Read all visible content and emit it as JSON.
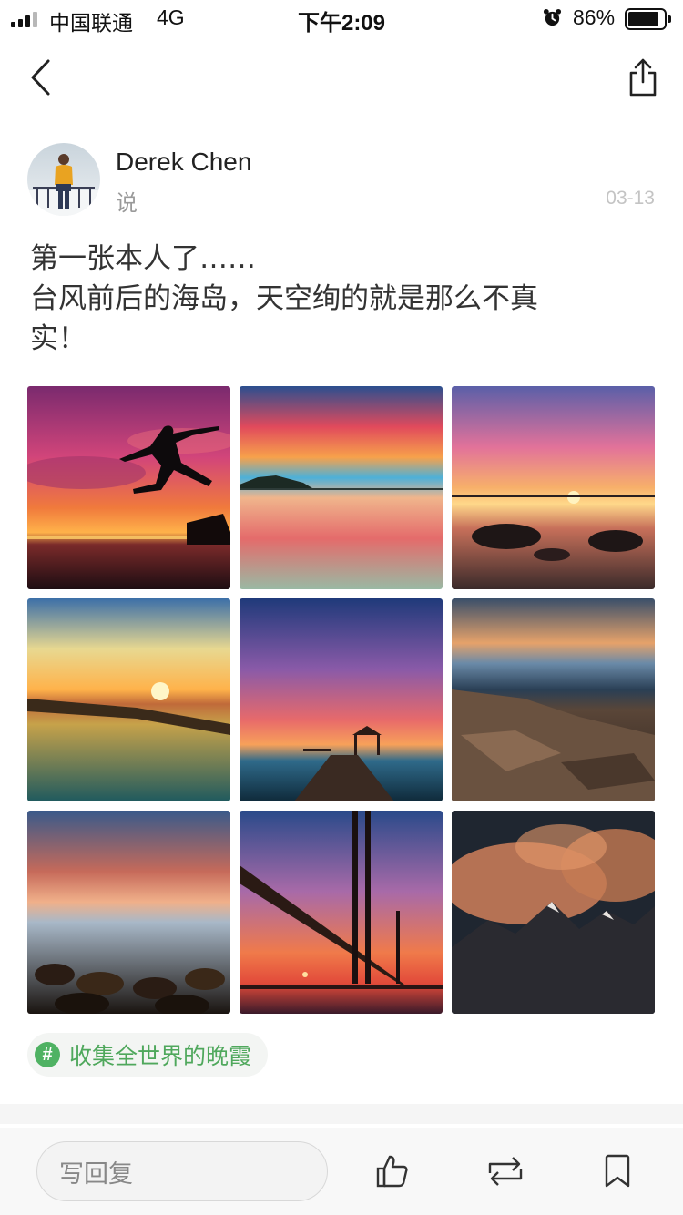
{
  "status_bar": {
    "carrier": "中国联通",
    "network": "4G",
    "time": "下午2:09",
    "battery_percent": "86%",
    "battery_level": 0.86,
    "signal_bars": 3,
    "icons": [
      "signal-icon",
      "alarm-icon",
      "battery-icon"
    ]
  },
  "nav": {
    "back_icon": "chevron-left-icon",
    "share_icon": "share-icon"
  },
  "post": {
    "author": "Derek Chen",
    "action": "说",
    "date": "03-13",
    "text_lines": [
      "第一张本人了……",
      "台风前后的海岛，天空绚的就是那么不真",
      "实！"
    ],
    "photos": [
      "jumping silhouette at sunset over sea",
      "sunset sky reflected on calm water",
      "sunrise over rocky shore",
      "golden sunset over lake shoreline",
      "purple clouds above pier pavilion",
      "rocky coastline at dusk",
      "stony beach under dramatic clouds",
      "cable-stayed bridge at sunset",
      "snowy mountains under orange clouds"
    ],
    "topic": {
      "icon": "hashtag-icon",
      "label": "收集全世界的晚霞"
    }
  },
  "bottom_bar": {
    "reply_placeholder": "写回复",
    "like_icon": "thumbs-up-icon",
    "repost_icon": "repost-icon",
    "bookmark_icon": "bookmark-icon"
  },
  "colors": {
    "accent_green": "#4fb263",
    "date_gray": "#c4c4c4",
    "text_dark": "#333333"
  }
}
